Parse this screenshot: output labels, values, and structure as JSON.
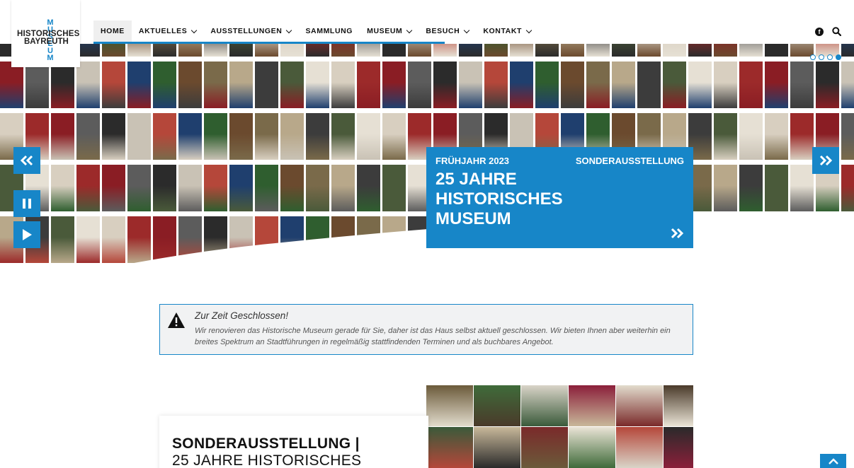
{
  "brand": {
    "logo_letter_m": "M U S E U M",
    "logo_line1": "HISTORISCHES",
    "logo_line2": "BAYREUTH",
    "accent": "#1786c8"
  },
  "nav": {
    "items": [
      {
        "label": "HOME",
        "active": true,
        "dropdown": false
      },
      {
        "label": "AKTUELLES",
        "active": false,
        "dropdown": true
      },
      {
        "label": "AUSSTELLUNGEN",
        "active": false,
        "dropdown": true
      },
      {
        "label": "SAMMLUNG",
        "active": false,
        "dropdown": false
      },
      {
        "label": "MUSEUM",
        "active": false,
        "dropdown": true
      },
      {
        "label": "BESUCH",
        "active": false,
        "dropdown": true
      },
      {
        "label": "KONTAKT",
        "active": false,
        "dropdown": true
      }
    ],
    "facebook_icon": "facebook-icon",
    "search_icon": "search-icon"
  },
  "slider": {
    "dots": 4,
    "active_dot": 4,
    "prev_icon": "double-chevron-left-icon",
    "next_icon": "double-chevron-right-icon",
    "pause_icon": "pause-icon",
    "play_icon": "play-icon",
    "feature": {
      "season": "FRÜHJAHR 2023",
      "kind": "SONDERAUSSTELLUNG",
      "title": "25 JAHRE HISTORISCHES MUSEUM",
      "more_icon": "double-chevron-right-icon"
    }
  },
  "notice": {
    "icon": "warning-icon",
    "title": "Zur Zeit Geschlossen!",
    "text": "Wir renovieren das Historische Museum gerade für Sie, daher ist das Haus selbst aktuell geschlossen. Wir bieten Ihnen aber weiterhin ein breites Spektrum an Stadtführungen in regelmäßig stattfindenden Terminen und als buchbares Angebot."
  },
  "section": {
    "title_line1": "SONDERAUSSTELLUNG |",
    "title_line2": "25 JAHRE HISTORISCHES",
    "back_to_top_icon": "chevron-up-icon"
  }
}
